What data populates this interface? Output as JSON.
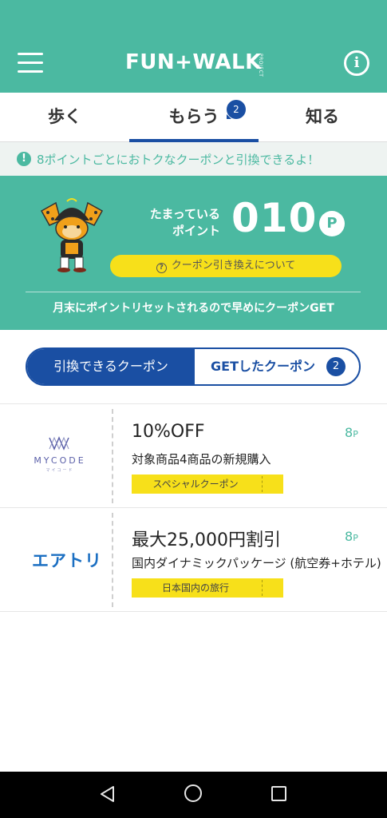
{
  "appbar": {
    "logo_text": "FUN+WALK",
    "logo_subtext": "PROJECT",
    "info_symbol": "i"
  },
  "tabs": [
    {
      "label": "歩く"
    },
    {
      "label": "もらう",
      "badge": "2",
      "selected": true
    },
    {
      "label": "知る"
    }
  ],
  "notice": {
    "icon": "!",
    "text": "8ポイントごとにおトクなクーポンと引換できるよ！"
  },
  "points": {
    "label_line1": "たまっている",
    "label_line2": "ポイント",
    "value": "010",
    "unit": "P",
    "about_button": "クーポン引き換えについて",
    "about_icon": "?",
    "note": "月末にポイントリセットされるので早めにクーポンGET"
  },
  "segment": {
    "left_label": "引換できるクーポン",
    "right_label": "GETしたクーポン",
    "right_badge": "2",
    "selected": "left"
  },
  "coupons": [
    {
      "brand": "MYCODE",
      "brand_sub": "マイコード",
      "title": "10%OFF",
      "description": "対象商品4商品の新規購入",
      "points": "8",
      "points_unit": "P",
      "tag": "スペシャルクーポン"
    },
    {
      "brand": "エアトリ",
      "title": "最大25,000円割引",
      "description": "国内ダイナミックパッケージ (航空券+ホテル)",
      "points": "8",
      "points_unit": "P",
      "tag": "日本国内の旅行"
    }
  ],
  "colors": {
    "brand_green": "#4bb9a1",
    "accent_blue": "#1a4fa3",
    "tag_yellow": "#f7e01a",
    "nav_black": "#000000"
  },
  "icons": {
    "menu": "hamburger-menu-icon",
    "info": "info-icon",
    "notice": "exclamation-icon",
    "help": "question-icon",
    "back": "back-triangle-icon",
    "home": "home-circle-icon",
    "recent": "recent-apps-square-icon"
  }
}
